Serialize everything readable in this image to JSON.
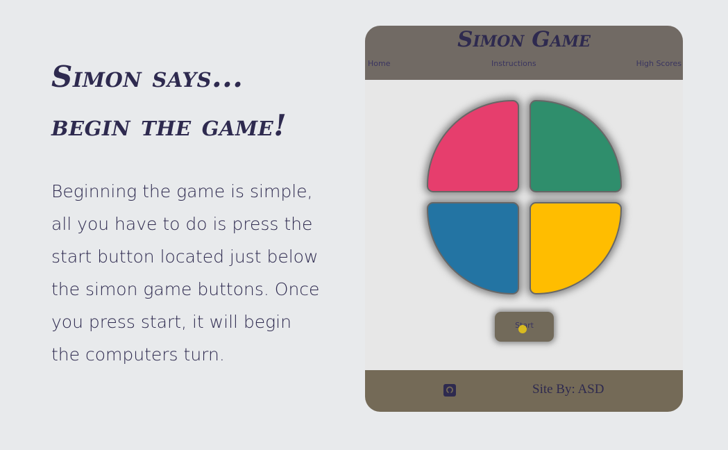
{
  "info": {
    "heading_line1": "Simon says...",
    "heading_line2": "begin the game!",
    "description": "Beginning the game is simple, all you have to do is press the start button located just below the simon game buttons. Once you press start, it will begin the computers turn."
  },
  "app": {
    "title": "Simon Game",
    "nav": {
      "home": "Home",
      "instructions": "Instructions",
      "high_scores": "High Scores"
    }
  },
  "game": {
    "start_label": "Start",
    "pads": [
      {
        "color_name": "red",
        "hex": "#e63e6d"
      },
      {
        "color_name": "green",
        "hex": "#2f8e6c"
      },
      {
        "color_name": "blue",
        "hex": "#2374a3"
      },
      {
        "color_name": "yellow",
        "hex": "#ffbd00"
      }
    ]
  },
  "footer": {
    "icon": "github-icon",
    "credit": "Site By: ASD"
  },
  "colors": {
    "text": "#2e2a4f",
    "header_bg": "#716a64",
    "footer_bg": "#746a57",
    "page_bg": "#e8eaec"
  }
}
